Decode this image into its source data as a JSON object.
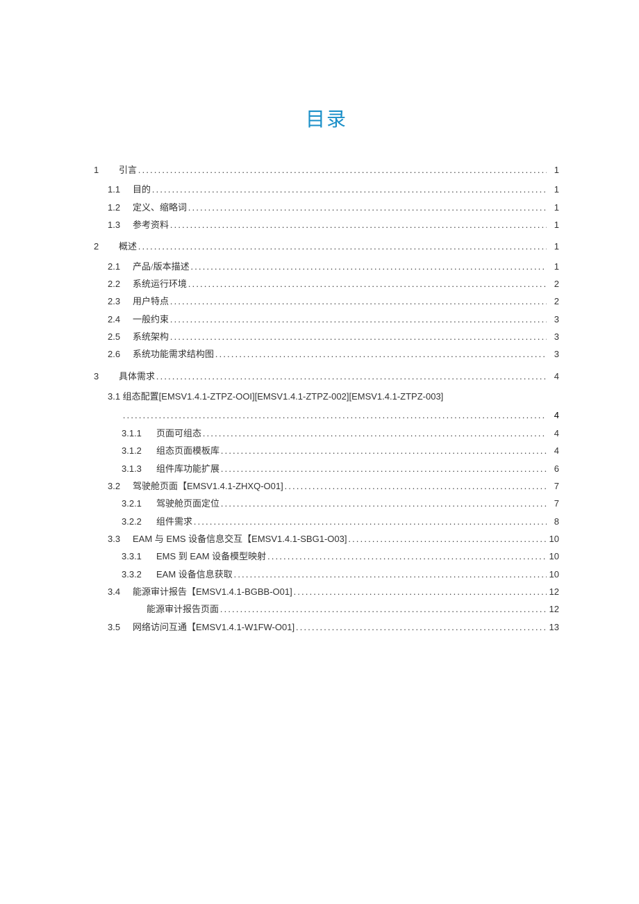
{
  "title": "目录",
  "toc": [
    {
      "level": "l1",
      "num": "1",
      "text": "引言",
      "page": "1",
      "mixed": false
    },
    {
      "level": "l2",
      "num": "1.1",
      "text": "目的",
      "page": "1",
      "mixed": false
    },
    {
      "level": "l2",
      "num": "1.2",
      "text": "定义、缩略词",
      "page": "1",
      "mixed": false
    },
    {
      "level": "l2",
      "num": "1.3",
      "text": "参考资料",
      "page": "1",
      "mixed": false
    },
    {
      "level": "l1",
      "num": "2",
      "text": "概述",
      "page": "1",
      "mixed": false
    },
    {
      "level": "l2",
      "num": "2.1",
      "text": "产品/版本描述",
      "page": "1",
      "mixed": false
    },
    {
      "level": "l2",
      "num": "2.2",
      "text": "系统运行环境",
      "page": "2",
      "mixed": false
    },
    {
      "level": "l2",
      "num": "2.3",
      "text": "用户特点",
      "page": "2",
      "mixed": false
    },
    {
      "level": "l2",
      "num": "2.4",
      "text": "一般约束",
      "page": "3",
      "mixed": false
    },
    {
      "level": "l2",
      "num": "2.5",
      "text": "系统架构",
      "page": "3",
      "mixed": false
    },
    {
      "level": "l2",
      "num": "2.6",
      "text": "系统功能需求结构图",
      "page": "3",
      "mixed": false
    },
    {
      "level": "l1",
      "num": "3",
      "text": "具体需求",
      "page": "4",
      "mixed": false
    }
  ],
  "multiline": {
    "num": "3.1",
    "text": "组态配置[EMSV1.4.1-ZTPZ-OOI][EMSV1.4.1-ZTPZ-002][EMSV1.4.1-ZTPZ-003]",
    "page": "4"
  },
  "toc2": [
    {
      "level": "l3",
      "num": "3.1.1",
      "text": "页面可组态",
      "page": "4",
      "mixed": false,
      "wide": true
    },
    {
      "level": "l3",
      "num": "3.1.2",
      "text": "组态页面模板库",
      "page": "4",
      "mixed": false,
      "wide": true
    },
    {
      "level": "l3",
      "num": "3.1.3",
      "text": "组件库功能扩展",
      "page": "6",
      "mixed": false,
      "wide": true
    },
    {
      "level": "l2",
      "num": "3.2",
      "text": "驾驶舱页面【EMSV1.4.1-ZHXQ-O01]",
      "page": "7",
      "mixed": true
    },
    {
      "level": "l3",
      "num": "3.2.1",
      "text": "驾驶舱页面定位",
      "page": "7",
      "mixed": false,
      "wide": true
    },
    {
      "level": "l3",
      "num": "3.2.2",
      "text": "组件需求",
      "page": "8",
      "mixed": false,
      "wide": true
    },
    {
      "level": "l2",
      "num": "3.3",
      "text": "EAM 与 EMS 设备信息交互【EMSV1.4.1-SBG1-O03]",
      "page": "10",
      "mixed": true
    },
    {
      "level": "l3",
      "num": "3.3.1",
      "text": "EMS 到 EAM 设备模型映射",
      "page": "10",
      "mixed": true,
      "wide": true
    },
    {
      "level": "l3",
      "num": "3.3.2",
      "text": "EAM 设备信息获取",
      "page": "10",
      "mixed": true,
      "wide": true
    },
    {
      "level": "l2",
      "num": "3.4",
      "text": "能源审计报告【EMSV1.4.1-BGBB-O01]",
      "page": "12",
      "mixed": true
    },
    {
      "level": "l3",
      "num": "",
      "text": "能源审计报告页面",
      "page": "12",
      "mixed": false,
      "wide": false
    },
    {
      "level": "l2",
      "num": "3.5",
      "text": "网络访问互通【EMSV1.4.1-W1FW-O01]",
      "page": "13",
      "mixed": true
    }
  ]
}
